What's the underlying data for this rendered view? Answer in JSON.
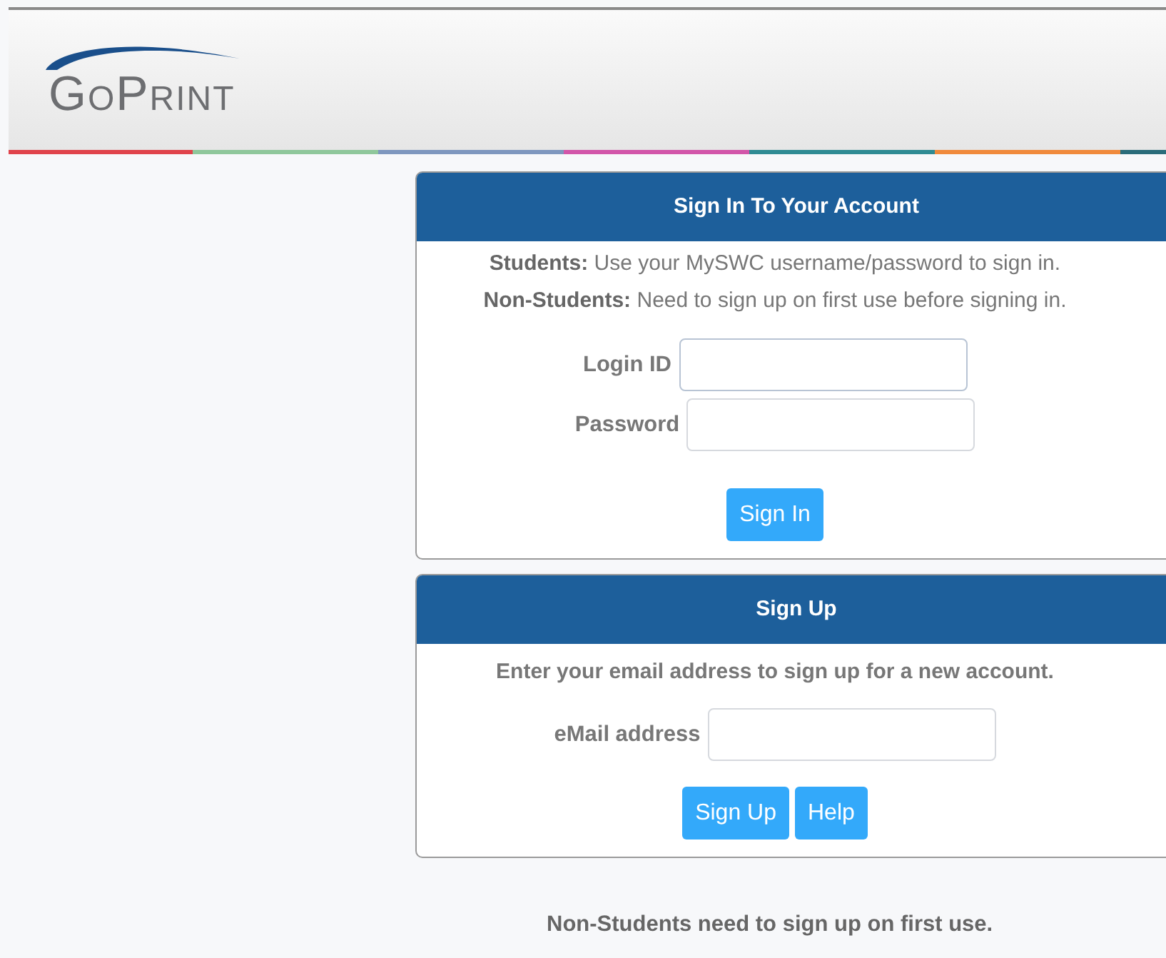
{
  "header": {
    "logo_text": "GoPrint"
  },
  "sign_in": {
    "title": "Sign In To Your Account",
    "notes": [
      {
        "label": "Students:",
        "text": "Use your MySWC username/password to sign in."
      },
      {
        "label": "Non-Students:",
        "text": "Need to sign up on first use before signing in."
      }
    ],
    "fields": [
      {
        "label": "Login ID",
        "focused": true
      },
      {
        "label": "Password",
        "focused": false
      }
    ],
    "buttons": [
      "Sign In"
    ]
  },
  "sign_up": {
    "title": "Sign Up",
    "intro": "Enter your email address to sign up for a new account.",
    "fields": [
      {
        "label": "eMail address",
        "focused": false
      }
    ],
    "buttons": [
      "Sign Up",
      "Help"
    ]
  },
  "footer_note": "Non-Students need to sign up on first use."
}
